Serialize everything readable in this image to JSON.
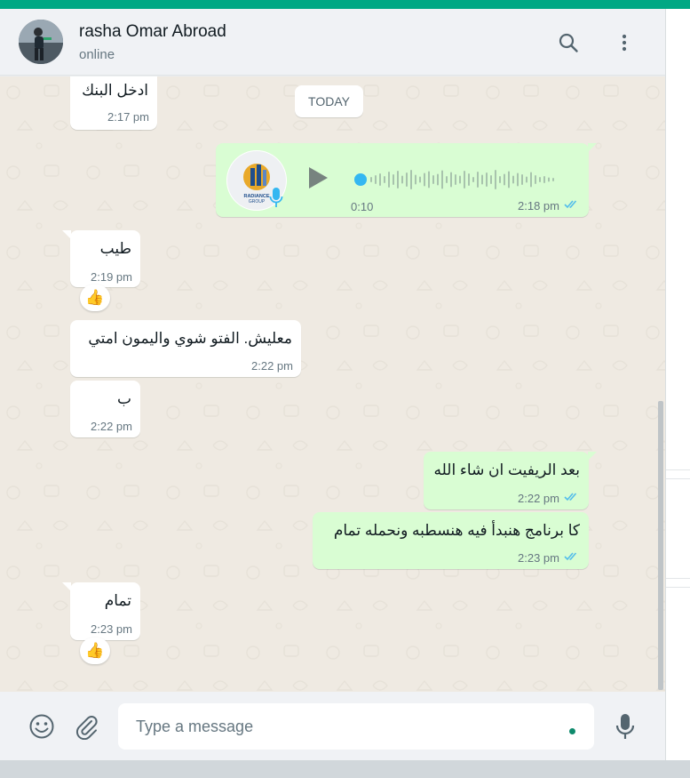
{
  "header": {
    "contact_name": "rasha Omar Abroad",
    "status": "online",
    "icons": [
      "search-icon",
      "menu-dots-icon"
    ]
  },
  "chat": {
    "date_separator": "TODAY",
    "messages": [
      {
        "direction": "incoming",
        "text": "ادخل البنك",
        "time": "2:17 pm"
      },
      {
        "direction": "outgoing",
        "type": "voice",
        "duration": "0:10",
        "time": "2:18 pm",
        "avatar_label": "RADIANCE GROUP",
        "status": "read"
      },
      {
        "direction": "incoming",
        "text": "طيب",
        "time": "2:19 pm",
        "reaction": "👍"
      },
      {
        "direction": "incoming",
        "text": "معليش. الفتو شوي واليمون امتي",
        "time": "2:22 pm"
      },
      {
        "direction": "incoming",
        "text": "ب",
        "time": "2:22 pm"
      },
      {
        "direction": "outgoing",
        "text": "بعد الريفيت ان شاء الله",
        "time": "2:22 pm",
        "status": "read"
      },
      {
        "direction": "outgoing",
        "text": "كا برنامج هنبدأ فيه هنسطبه ونحمله تمام",
        "time": "2:23 pm",
        "status": "read"
      },
      {
        "direction": "incoming",
        "text": "تمام",
        "time": "2:23 pm",
        "reaction": "👍"
      }
    ]
  },
  "footer": {
    "placeholder": "Type a message",
    "icons": [
      "emoji-icon",
      "attach-icon",
      "mic-icon"
    ]
  },
  "colors": {
    "accent": "#00a884",
    "outgoing_bubble": "#d9fdd3",
    "incoming_bubble": "#ffffff",
    "chat_background": "#efeae2",
    "read_ticks": "#53bdeb"
  }
}
